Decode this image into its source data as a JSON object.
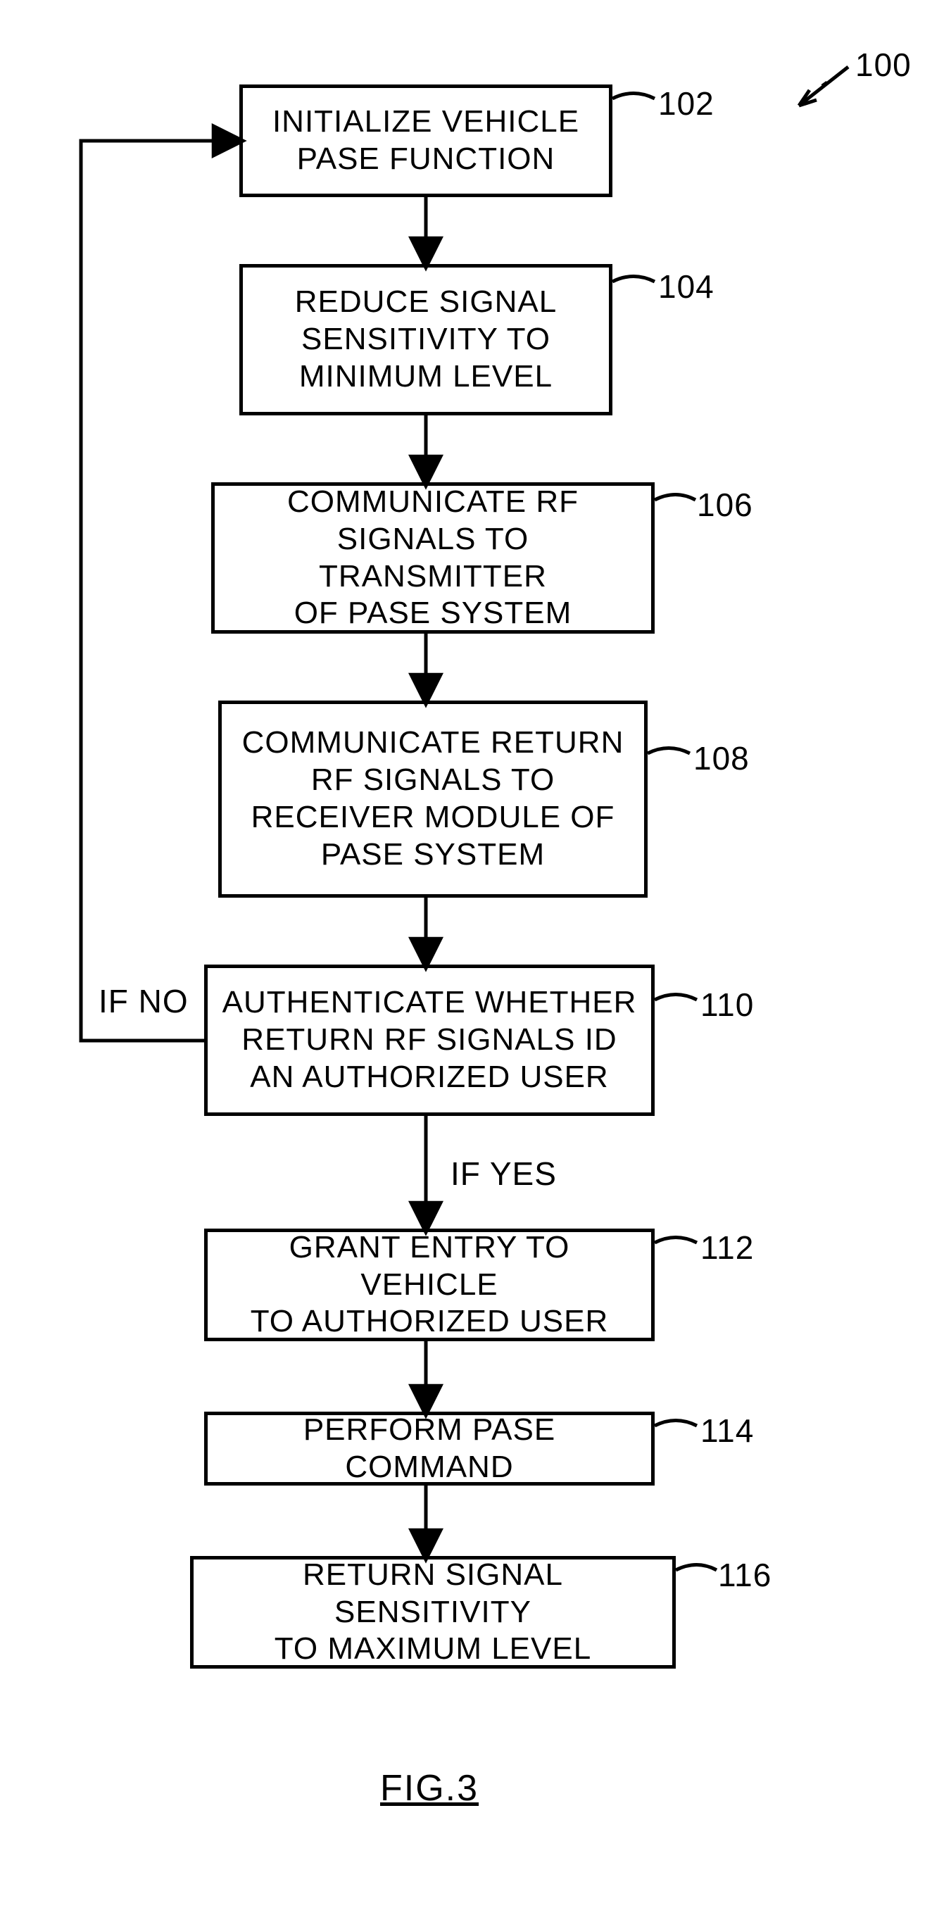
{
  "ref": {
    "main": "100"
  },
  "steps": {
    "s102": {
      "text": "INITIALIZE VEHICLE\nPASE FUNCTION",
      "ref": "102"
    },
    "s104": {
      "text": "REDUCE SIGNAL\nSENSITIVITY TO\nMINIMUM LEVEL",
      "ref": "104"
    },
    "s106": {
      "text": "COMMUNICATE RF\nSIGNALS TO TRANSMITTER\nOF PASE SYSTEM",
      "ref": "106"
    },
    "s108": {
      "text": "COMMUNICATE RETURN\nRF SIGNALS TO\nRECEIVER MODULE OF\nPASE SYSTEM",
      "ref": "108"
    },
    "s110": {
      "text": "AUTHENTICATE WHETHER\nRETURN RF SIGNALS ID\nAN AUTHORIZED USER",
      "ref": "110"
    },
    "s112": {
      "text": "GRANT ENTRY TO VEHICLE\nTO AUTHORIZED USER",
      "ref": "112"
    },
    "s114": {
      "text": "PERFORM PASE COMMAND",
      "ref": "114"
    },
    "s116": {
      "text": "RETURN SIGNAL SENSITIVITY\nTO MAXIMUM LEVEL",
      "ref": "116"
    }
  },
  "branches": {
    "no": "IF NO",
    "yes": "IF YES"
  },
  "figure": "FIG.3",
  "chart_data": {
    "type": "flowchart",
    "title": "FIG.3",
    "reference": "100",
    "nodes": [
      {
        "id": "102",
        "label": "INITIALIZE VEHICLE PASE FUNCTION"
      },
      {
        "id": "104",
        "label": "REDUCE SIGNAL SENSITIVITY TO MINIMUM LEVEL"
      },
      {
        "id": "106",
        "label": "COMMUNICATE RF SIGNALS TO TRANSMITTER OF PASE SYSTEM"
      },
      {
        "id": "108",
        "label": "COMMUNICATE RETURN RF SIGNALS TO RECEIVER MODULE OF PASE SYSTEM"
      },
      {
        "id": "110",
        "label": "AUTHENTICATE WHETHER RETURN RF SIGNALS ID AN AUTHORIZED USER"
      },
      {
        "id": "112",
        "label": "GRANT ENTRY TO VEHICLE TO AUTHORIZED USER"
      },
      {
        "id": "114",
        "label": "PERFORM PASE COMMAND"
      },
      {
        "id": "116",
        "label": "RETURN SIGNAL SENSITIVITY TO MAXIMUM LEVEL"
      }
    ],
    "edges": [
      {
        "from": "102",
        "to": "104"
      },
      {
        "from": "104",
        "to": "106"
      },
      {
        "from": "106",
        "to": "108"
      },
      {
        "from": "108",
        "to": "110"
      },
      {
        "from": "110",
        "to": "112",
        "label": "IF YES"
      },
      {
        "from": "110",
        "to": "102",
        "label": "IF NO"
      },
      {
        "from": "112",
        "to": "114"
      },
      {
        "from": "114",
        "to": "116"
      }
    ]
  }
}
